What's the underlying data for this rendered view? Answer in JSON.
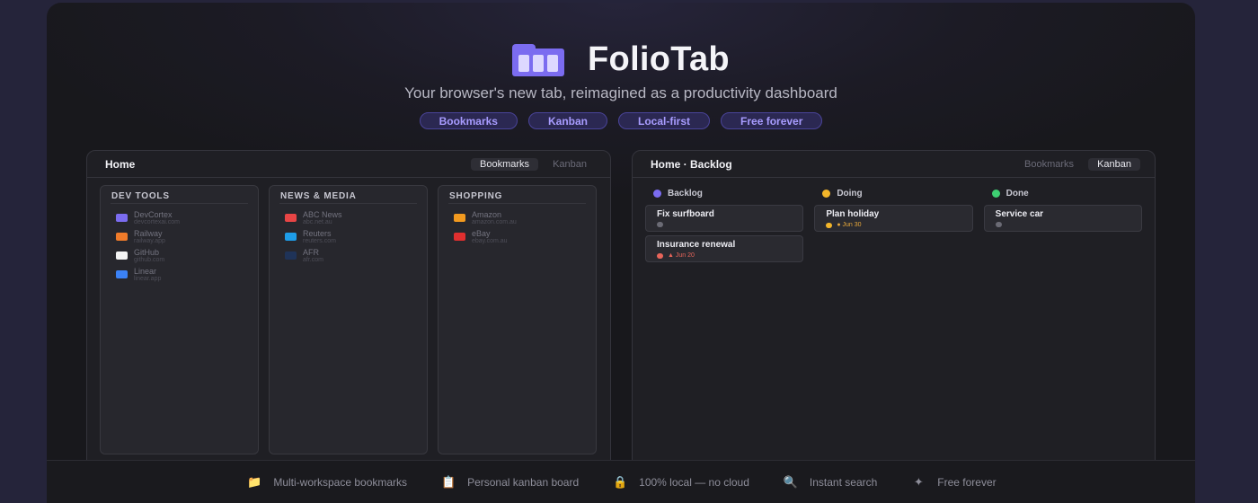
{
  "app": {
    "title": "FolioTab",
    "subtitle": "Your browser's new tab, reimagined as a productivity dashboard",
    "pills": [
      "Bookmarks",
      "Kanban",
      "Local-first",
      "Free forever"
    ]
  },
  "bookmarks_panel": {
    "title": "Home",
    "toggle": {
      "bookmarks": "Bookmarks",
      "kanban": "Kanban",
      "active": "bookmarks"
    },
    "columns": [
      {
        "title": "DEV TOOLS",
        "items": [
          {
            "name": "DevCortex",
            "url": "devcortexai.com",
            "color": "#7b6cf0"
          },
          {
            "name": "Railway",
            "url": "railway.app",
            "color": "#f07b2a"
          },
          {
            "name": "GitHub",
            "url": "github.com",
            "color": "#f4f4f4"
          },
          {
            "name": "Linear",
            "url": "linear.app",
            "color": "#3b82f6"
          }
        ]
      },
      {
        "title": "NEWS & MEDIA",
        "items": [
          {
            "name": "ABC News",
            "url": "abc.net.au",
            "color": "#e84545"
          },
          {
            "name": "Reuters",
            "url": "reuters.com",
            "color": "#1e9de8"
          },
          {
            "name": "AFR",
            "url": "afr.com",
            "color": "#1f3358"
          }
        ]
      },
      {
        "title": "SHOPPING",
        "items": [
          {
            "name": "Amazon",
            "url": "amazon.com.au",
            "color": "#f29a1f"
          },
          {
            "name": "eBay",
            "url": "ebay.com.au",
            "color": "#e02f2f"
          }
        ]
      }
    ]
  },
  "kanban_panel": {
    "title": "Home · Backlog",
    "toggle": {
      "bookmarks": "Bookmarks",
      "kanban": "Kanban",
      "active": "kanban"
    },
    "columns": [
      {
        "name": "Backlog",
        "color": "#7b6cf0",
        "cards": [
          {
            "title": "Fix surfboard",
            "dot": "#6b6b75",
            "due": ""
          },
          {
            "title": "Insurance renewal",
            "dot": "#e8655a",
            "due": "▲ Jun 20",
            "due_color": "red"
          }
        ]
      },
      {
        "name": "Doing",
        "color": "#f2b52a",
        "cards": [
          {
            "title": "Plan holiday",
            "dot": "#f2b52a",
            "due": "● Jun 30",
            "due_color": "orange"
          }
        ]
      },
      {
        "name": "Done",
        "color": "#3ecf72",
        "cards": [
          {
            "title": "Service car",
            "dot": "#6b6b75",
            "due": ""
          }
        ]
      }
    ]
  },
  "footer": {
    "features": [
      {
        "icon": "📁",
        "icon_name": "folder-icon",
        "label": "Multi-workspace bookmarks"
      },
      {
        "icon": "📋",
        "icon_name": "clipboard-icon",
        "label": "Personal kanban board"
      },
      {
        "icon": "🔒",
        "icon_name": "lock-icon",
        "label": "100% local — no cloud"
      },
      {
        "icon": "🔍",
        "icon_name": "search-icon",
        "label": "Instant search"
      },
      {
        "icon": "✦",
        "icon_name": "sparkle-icon",
        "label": "Free forever"
      }
    ]
  }
}
